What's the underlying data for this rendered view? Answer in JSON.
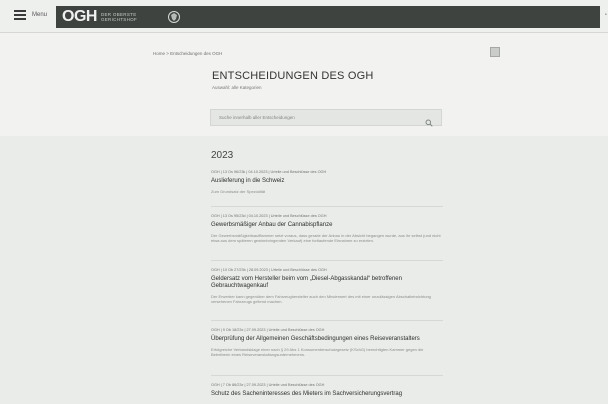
{
  "header": {
    "menu_label": "Menu",
    "brand_logo": "OGH",
    "brand_sub_line1": "Der Oberste",
    "brand_sub_line2": "Gerichtshof"
  },
  "breadcrumb": "Home > Entscheidungen des OGH",
  "page": {
    "title": "ENTSCHEIDUNGEN DES OGH",
    "subtitle": "Auswahl: alle Kategorien"
  },
  "search": {
    "placeholder": "Suche innerhalb aller Entscheidungen"
  },
  "year": "2023",
  "entries": [
    {
      "meta": "OGH | 13 Os 96/23k | 04.10.2023 | Urteile und Beschlüsse des OGH",
      "title": "Auslieferung in die Schweiz",
      "desc": "Zum Grundsatz der Spezialität"
    },
    {
      "meta": "OGH | 13 Os 95/23d | 04.10.2023 | Urteile und Beschlüsse des OGH",
      "title": "Gewerbsmäßiger Anbau der Cannabispflanze",
      "desc": "Der Gewerbsmäßigkeitsaufflammer setzt voraus, dass gerade der Anbau in der Absicht begangen wurde, aus ihr selbst (und nicht etwa aus dem späteren gewinnbringenden Verkauf) eine fortlaufende Einnahme zu erzielen."
    },
    {
      "meta": "OGH | 10 Ob 27/23b | 28.09.2023 | Urteile und Beschlüsse des OGH",
      "title": "Geldersatz vom Hersteller beim vom „Diesel-Abgasskandal“ betroffenen Gebrauchtwagenkauf",
      "desc": "Der Erwerber kann gegenüber dem Fahrzeughersteller auch den Minderwert des mit einer unzulässigen Abschalteinrichtung versehenen Fahrzeugs geltend machen."
    },
    {
      "meta": "OGH | 9 Ob 18/23x | 27.09.2023 | Urteile und Beschlüsse des OGH",
      "title": "Überprüfung der Allgemeinen Geschäftsbedingungen eines Reiseveranstalters",
      "desc": "Erfolgreiche Verbandsklage einer nach § 29 Abs 1 Konsumentenschutzgesetz (KSchG) berechtigten Kammer gegen die Betreiberin eines Reiseveranstaltungsunternehmens."
    },
    {
      "meta": "OGH | 7 Ob 86/23x | 27.09.2023 | Urteile und Beschlüsse des OGH",
      "title": "Schutz des Sacheninteresses des Mieters im Sachversicherungsvertrag",
      "desc": ""
    }
  ]
}
